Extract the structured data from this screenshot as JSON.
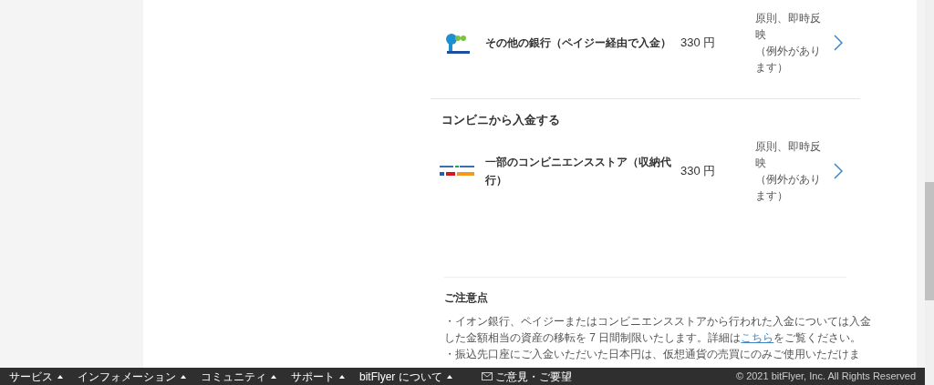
{
  "methods": [
    {
      "kind": "payeasy",
      "name": "その他の銀行（ペイジー経由で入金）",
      "fee": "330 円",
      "timing": [
        "原則、即時反映",
        "（例外があります）"
      ]
    }
  ],
  "convenience": {
    "heading": "コンビニから入金する",
    "methods": [
      {
        "kind": "stores",
        "name": "一部のコンビニエンスストア（収納代行）",
        "fee": "330 円",
        "timing": [
          "原則、即時反映",
          "（例外があります）"
        ]
      }
    ]
  },
  "notes": {
    "title": "ご注意点",
    "items": [
      {
        "before": "・イオン銀行、ペイジーまたはコンビニエンスストアから行われた入金については入金した金額相当の資産の移転を 7 日間制限いたします。詳細は",
        "link": "こちら",
        "after": "をご覧ください。"
      },
      {
        "before": "・振込先口座にご入金いただいた日本円は、仮想通貨の売買にのみご使用いただけま"
      }
    ]
  },
  "footer": {
    "menus": [
      "サービス",
      "インフォメーション",
      "コミュニティ",
      "サポート",
      "bitFlyer について"
    ],
    "feedback": "ご意見・ご要望",
    "copyright": "© 2021 bitFlyer, Inc. All Rights Reserved"
  }
}
